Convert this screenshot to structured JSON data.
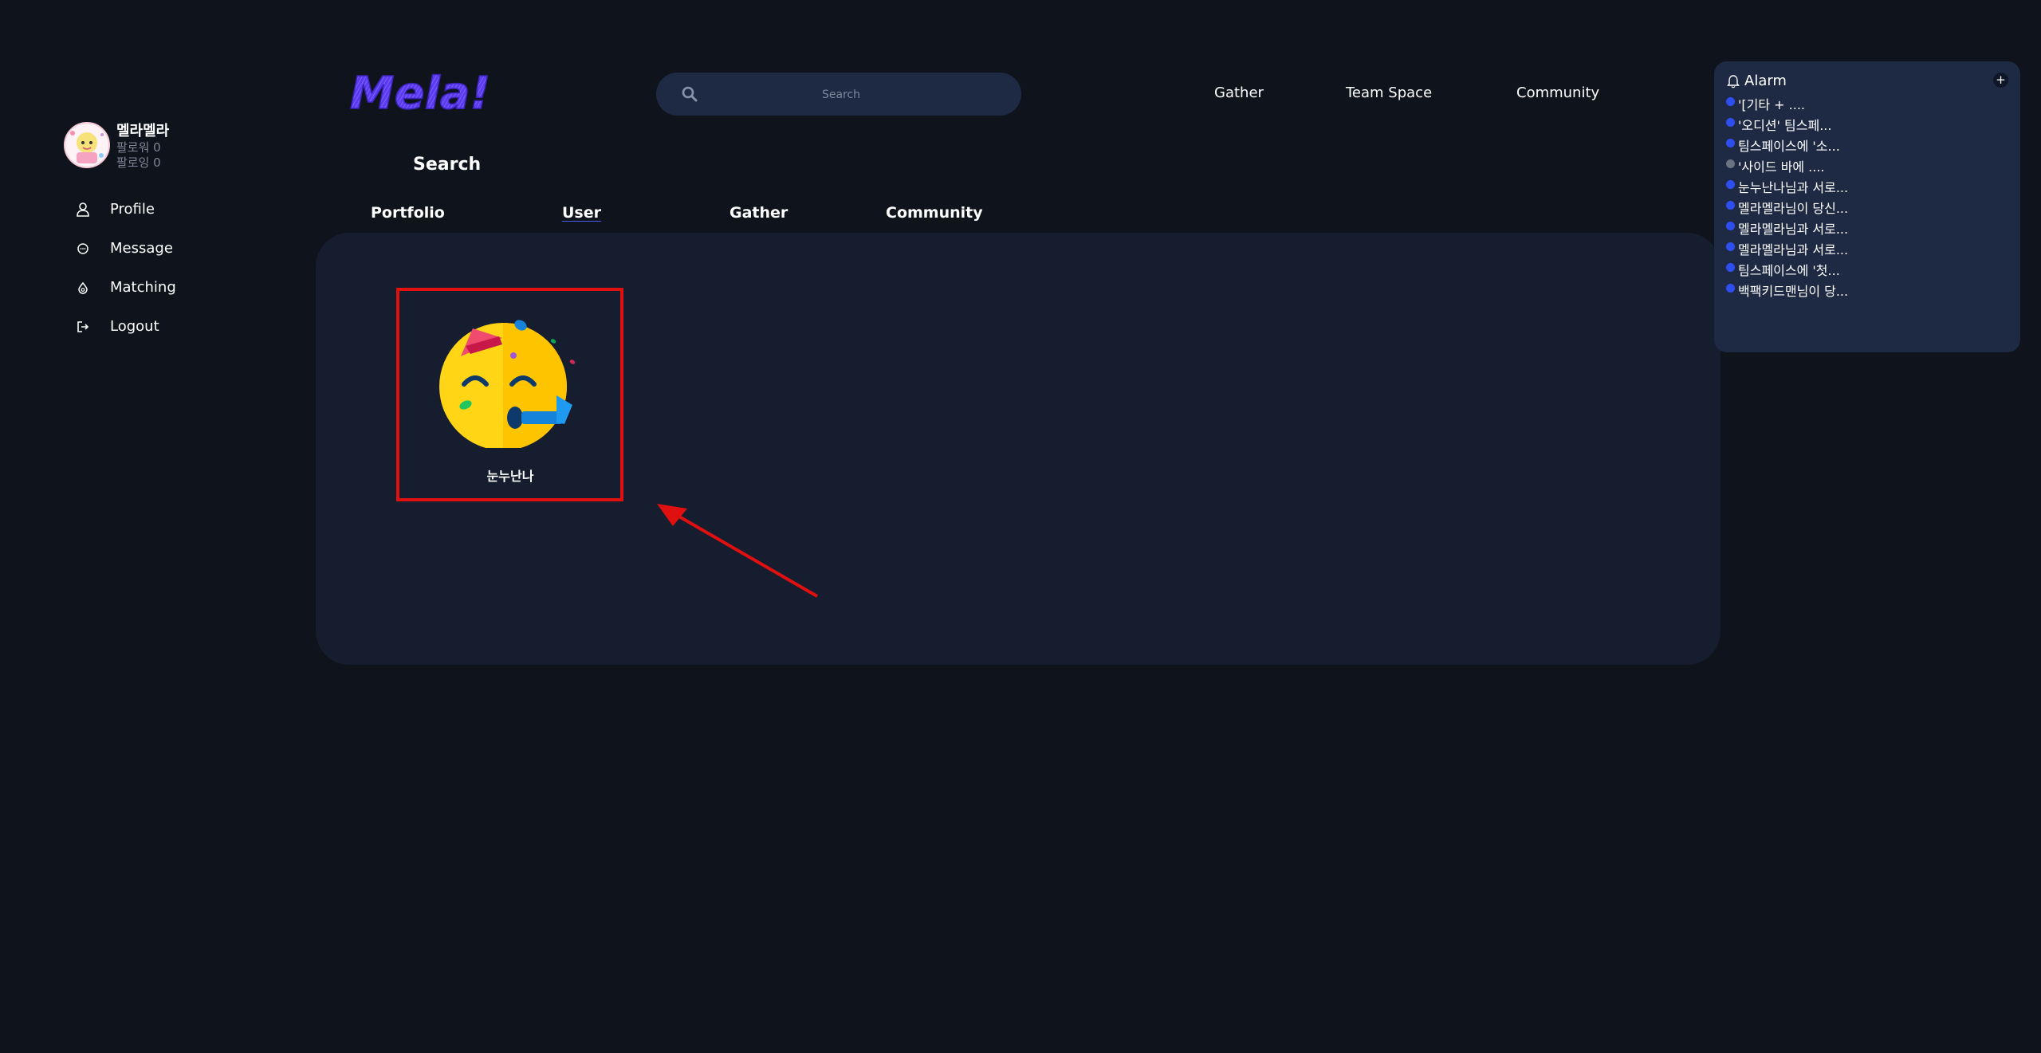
{
  "sidebar": {
    "user": {
      "name": "멜라멜라",
      "followers": "팔로워 0",
      "following": "팔로잉 0"
    },
    "menu": [
      {
        "label": "Profile",
        "icon": "user-icon"
      },
      {
        "label": "Message",
        "icon": "message-icon"
      },
      {
        "label": "Matching",
        "icon": "matching-icon"
      },
      {
        "label": "Logout",
        "icon": "logout-icon"
      }
    ]
  },
  "header": {
    "logo_text": "Mela!",
    "logo_color": "#5b3bf0",
    "search": {
      "placeholder": "Search",
      "value": ""
    },
    "nav": [
      "Gather",
      "Team Space",
      "Community"
    ]
  },
  "search_page": {
    "title": "Search",
    "tabs": [
      "Portfolio",
      "User",
      "Gather",
      "Community"
    ],
    "active_tab": "User",
    "results": [
      {
        "name": "눈누난나",
        "avatar": "party-face-emoji"
      }
    ]
  },
  "alarm": {
    "title": "Alarm",
    "add_label": "+",
    "items": [
      {
        "text": "'[기타 + ....",
        "status": "unread"
      },
      {
        "text": "'오디션' 팀스페...",
        "status": "unread"
      },
      {
        "text": "팀스페이스에 '소...",
        "status": "unread"
      },
      {
        "text": "'사이드 바에 ....",
        "status": "read"
      },
      {
        "text": "눈누난나님과 서로...",
        "status": "unread"
      },
      {
        "text": "멜라멜라님이 당신...",
        "status": "unread"
      },
      {
        "text": "멜라멜라님과 서로...",
        "status": "unread"
      },
      {
        "text": "멜라멜라님과 서로...",
        "status": "unread"
      },
      {
        "text": "팀스페이스에 '첫...",
        "status": "unread"
      },
      {
        "text": "백팩키드맨님이 당...",
        "status": "unread"
      }
    ]
  },
  "colors": {
    "background": "#0f131c",
    "panel": "#161d2e",
    "search_bg": "#1e2a44",
    "accent": "#4b5ef2",
    "unread_dot": "#2f4ef0",
    "read_dot": "#6b7280",
    "highlight": "#e01010"
  }
}
